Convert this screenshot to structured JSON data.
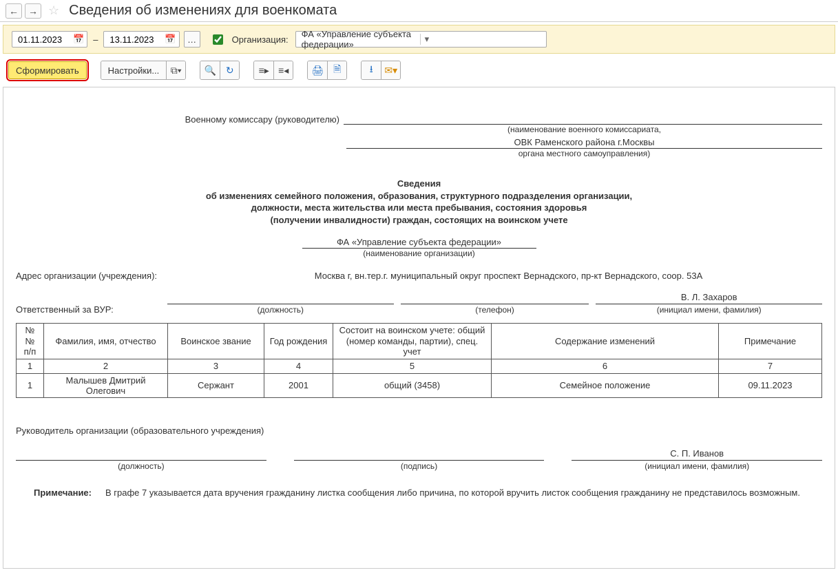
{
  "header": {
    "title": "Сведения об изменениях для военкомата"
  },
  "filter": {
    "date_from": "01.11.2023",
    "date_to": "13.11.2023",
    "org_label": "Организация:",
    "org_value": "ФА «Управление субъекта федерации»"
  },
  "toolbar": {
    "generate": "Сформировать",
    "settings": "Настройки..."
  },
  "report": {
    "addressee": "Военному комиссару (руководителю)",
    "addressee_hint": "(наименование военного комиссариата,",
    "ovk": "ОВК Раменского района г.Москвы",
    "ovk_hint": "органа местного самоуправления)",
    "title1": "Сведения",
    "title2": "об изменениях семейного положения, образования, структурного подразделения организации,",
    "title3": "должности, места жительства или места пребывания, состояния здоровья",
    "title4": "(получении инвалидности) граждан, состоящих на воинском учете",
    "org_name": "ФА «Управление субъекта федерации»",
    "org_hint": "(наименование организации)",
    "addr_label": "Адрес организации (учреждения):",
    "addr_value": "Москва г, вн.тер.г. муниципальный округ проспект Вернадского, пр-кт Вернадского, соор. 53А",
    "resp_label": "Ответственный за ВУР:",
    "resp_name": "В. Л. Захаров",
    "cap_post": "(должность)",
    "cap_phone": "(телефон)",
    "cap_name": "(инициал имени, фамилия)",
    "cap_sign": "(подпись)",
    "th": {
      "num": "№ №\nп/п",
      "fio": "Фамилия, имя, отчество",
      "rank": "Воинское звание",
      "year": "Год рождения",
      "reg": "Состоит на воинском учете: общий (номер команды, партии), спец. учет",
      "change": "Содержание изменений",
      "note": "Примечание"
    },
    "nums": [
      "1",
      "2",
      "3",
      "4",
      "5",
      "6",
      "7"
    ],
    "rows": [
      {
        "n": "1",
        "fio": "Малышев Дмитрий Олегович",
        "rank": "Сержант",
        "year": "2001",
        "reg": "общий (3458)",
        "change": "Семейное положение",
        "note": "09.11.2023"
      }
    ],
    "footer_head": "Руководитель организации (образовательного учреждения)",
    "sign_name": "С. П. Иванов",
    "note_label": "Примечание:",
    "note_text": "В графе 7 указывается дата вручения гражданину листка сообщения либо причина, по которой вручить листок сообщения гражданину не представилось возможным."
  }
}
